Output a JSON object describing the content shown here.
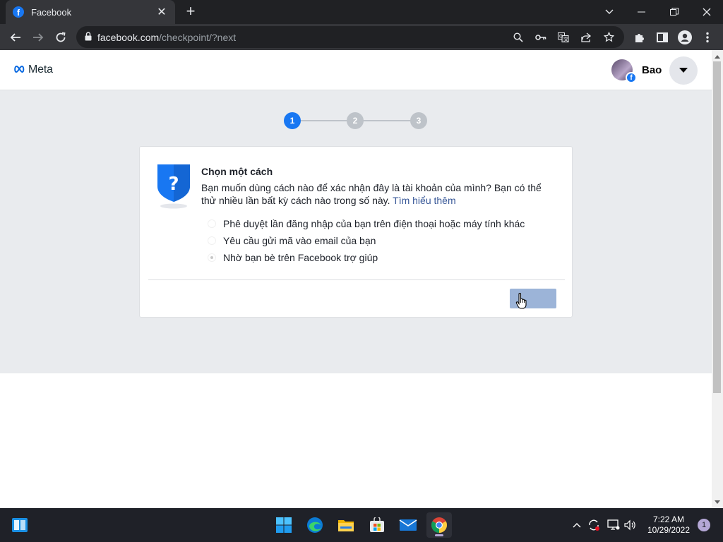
{
  "browser": {
    "tab": {
      "title": "Facebook",
      "favicon": "facebook-favicon"
    },
    "omnibox": {
      "host": "facebook.com",
      "path": "/checkpoint/?next"
    },
    "colors": {
      "frame": "#202124",
      "toolbar": "#35363a"
    }
  },
  "header": {
    "logo_text": "Meta",
    "user_name": "Bao"
  },
  "steps": [
    "1",
    "2",
    "3"
  ],
  "active_step": 1,
  "card": {
    "title": "Chọn một cách",
    "description": "Bạn muốn dùng cách nào để xác nhận đây là tài khoản của mình? Bạn có thể thử nhiều lần bất kỳ cách nào trong số này.",
    "learn_more": "Tìm hiểu thêm",
    "options": [
      {
        "label": "Phê duyệt lần đăng nhập của bạn trên điện thoại hoặc máy tính khác",
        "selected": false
      },
      {
        "label": "Yêu cầu gửi mã vào email của bạn",
        "selected": false
      },
      {
        "label": "Nhờ bạn bè trên Facebook trợ giúp",
        "selected": true
      }
    ],
    "continue_label": ""
  },
  "taskbar": {
    "clock_time": "7:22 AM",
    "clock_date": "10/29/2022",
    "notification_count": "1"
  },
  "colors": {
    "facebook_blue": "#1877f2",
    "page_bg": "#e9ebee",
    "link": "#385898",
    "disabled_button": "#9cb4d8"
  }
}
